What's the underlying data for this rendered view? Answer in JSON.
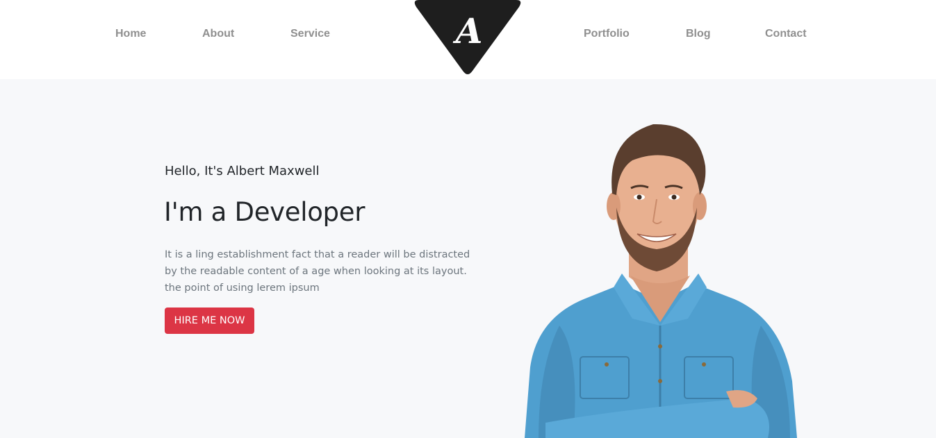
{
  "nav": {
    "left": [
      "Home",
      "About",
      "Service"
    ],
    "right": [
      "Portfolio",
      "Blog",
      "Contact"
    ]
  },
  "logo": {
    "letter": "A"
  },
  "hero": {
    "greeting": "Hello, It's Albert Maxwell",
    "headline": "I'm a Developer",
    "description": "It is a ling establishment fact that a reader will be distracted by the readable content of a age when looking at its layout. the point of using lerem ipsum",
    "cta_label": "HIRE ME NOW"
  },
  "colors": {
    "hero_background": "#f7f8fa",
    "cta": "#dc3545",
    "nav_text": "#8f8f8f",
    "logo": "#1e1e1e",
    "shirt": "#4f9fcf"
  }
}
